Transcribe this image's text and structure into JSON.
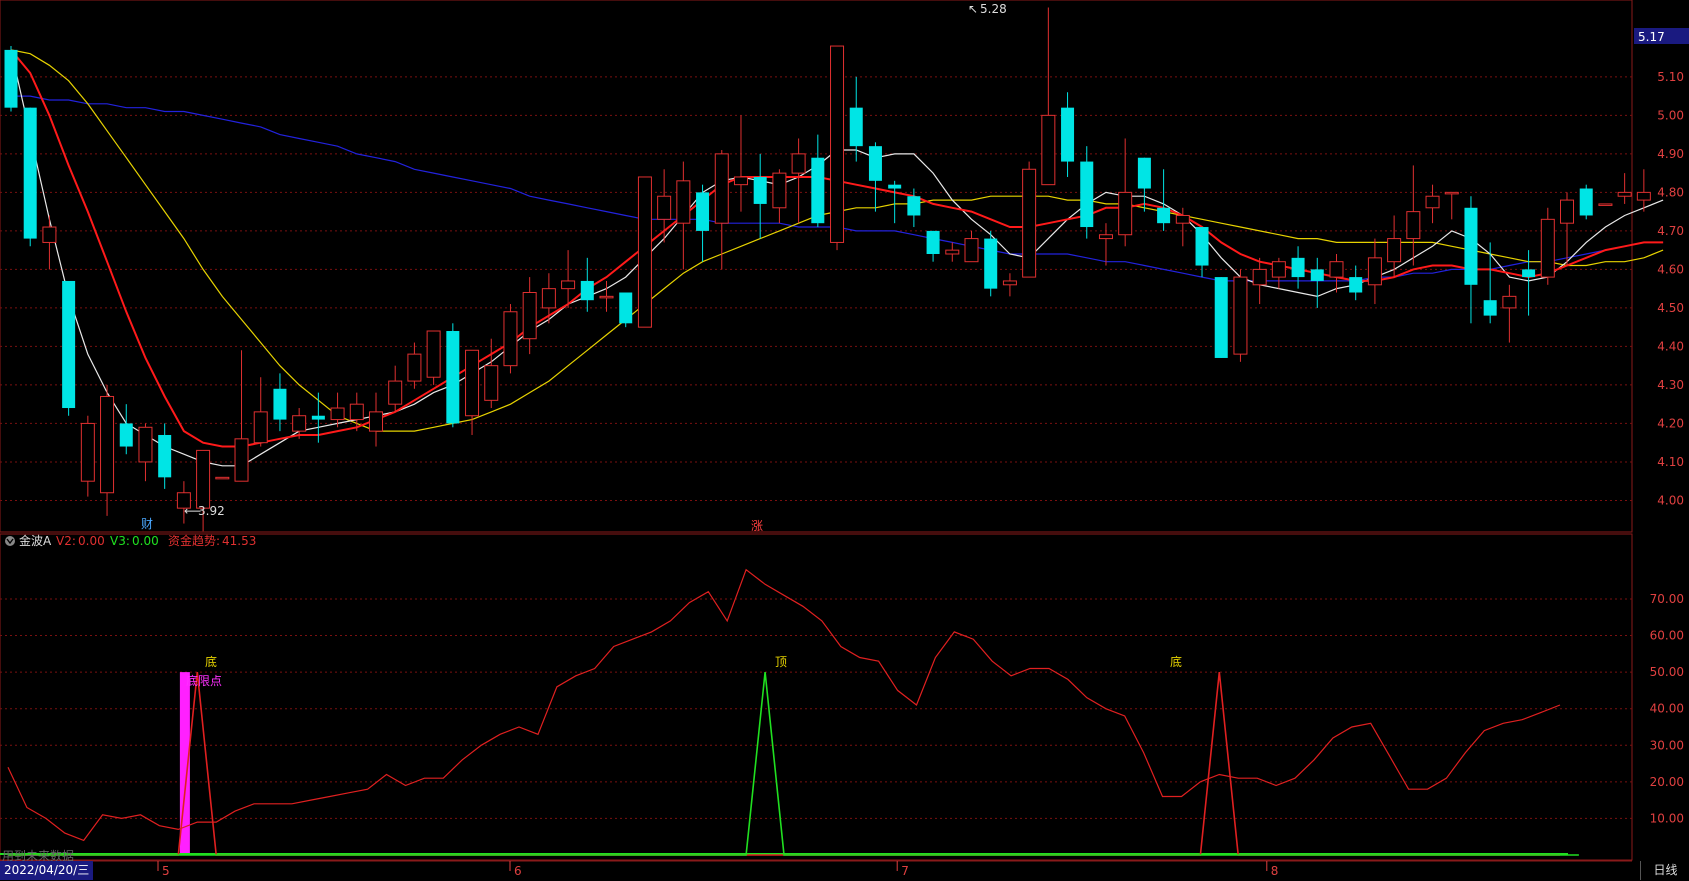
{
  "indicator": {
    "name": "金波A",
    "v2_label": "V2:",
    "v2_value": "0.00",
    "v3_label": "V3:",
    "v3_value": "0.00",
    "trend_label": "资金趋势:",
    "trend_value": "41.53"
  },
  "labels": {
    "price_high": "5.28",
    "price_low": "3.92",
    "event_cai": "财",
    "event_zhang": "涨",
    "signal_di": "底",
    "signal_ding": "顶",
    "signal_didian": "底限点",
    "current_price": "5.17",
    "future_note": "用到未来数据",
    "date": "2022/04/20/三",
    "period": "日线"
  },
  "chart_data": [
    {
      "type": "candlestick",
      "y_ticks": [
        4.0,
        4.1,
        4.2,
        4.3,
        4.4,
        4.5,
        4.6,
        4.7,
        4.8,
        4.9,
        5.0,
        5.1
      ],
      "y_tick_labels": [
        "4.00",
        "4.10",
        "4.20",
        "4.30",
        "4.40",
        "4.50",
        "4.60",
        "4.70",
        "4.80",
        "4.90",
        "5.00",
        "5.10"
      ],
      "ylim": [
        3.9,
        5.3
      ],
      "x_month_labels": [
        {
          "index": 8,
          "label": "5"
        },
        {
          "index": 28,
          "label": "6"
        },
        {
          "index": 50,
          "label": "7"
        },
        {
          "index": 71,
          "label": "8"
        }
      ],
      "candles": [
        [
          5.17,
          5.02,
          5.18,
          5.01
        ],
        [
          5.02,
          4.68,
          5.02,
          4.66
        ],
        [
          4.67,
          4.71,
          4.74,
          4.6
        ],
        [
          4.57,
          4.24,
          4.57,
          4.22
        ],
        [
          4.05,
          4.2,
          4.22,
          4.01
        ],
        [
          4.02,
          4.27,
          4.3,
          3.96
        ],
        [
          4.2,
          4.14,
          4.25,
          4.12
        ],
        [
          4.1,
          4.19,
          4.2,
          4.05
        ],
        [
          4.17,
          4.06,
          4.2,
          4.03
        ],
        [
          3.98,
          4.02,
          4.05,
          3.94
        ],
        [
          3.98,
          4.13,
          4.13,
          3.92
        ],
        [
          4.06,
          4.06,
          4.06,
          4.06
        ],
        [
          4.05,
          4.16,
          4.39,
          4.05
        ],
        [
          4.15,
          4.23,
          4.32,
          4.14
        ],
        [
          4.29,
          4.21,
          4.33,
          4.18
        ],
        [
          4.18,
          4.22,
          4.24,
          4.16
        ],
        [
          4.22,
          4.21,
          4.28,
          4.15
        ],
        [
          4.21,
          4.24,
          4.28,
          4.19
        ],
        [
          4.21,
          4.25,
          4.28,
          4.18
        ],
        [
          4.18,
          4.23,
          4.28,
          4.14
        ],
        [
          4.25,
          4.31,
          4.35,
          4.23
        ],
        [
          4.31,
          4.38,
          4.41,
          4.29
        ],
        [
          4.32,
          4.44,
          4.44,
          4.3
        ],
        [
          4.44,
          4.2,
          4.46,
          4.19
        ],
        [
          4.22,
          4.39,
          4.39,
          4.17
        ],
        [
          4.26,
          4.35,
          4.42,
          4.24
        ],
        [
          4.35,
          4.49,
          4.51,
          4.33
        ],
        [
          4.42,
          4.54,
          4.58,
          4.38
        ],
        [
          4.5,
          4.55,
          4.59,
          4.46
        ],
        [
          4.55,
          4.57,
          4.65,
          4.5
        ],
        [
          4.57,
          4.52,
          4.63,
          4.49
        ],
        [
          4.53,
          4.53,
          4.57,
          4.49
        ],
        [
          4.54,
          4.46,
          4.54,
          4.45
        ],
        [
          4.45,
          4.84,
          4.84,
          4.45
        ],
        [
          4.73,
          4.79,
          4.86,
          4.67
        ],
        [
          4.72,
          4.83,
          4.88,
          4.6
        ],
        [
          4.8,
          4.7,
          4.82,
          4.62
        ],
        [
          4.72,
          4.9,
          4.91,
          4.6
        ],
        [
          4.82,
          4.84,
          5.0,
          4.75
        ],
        [
          4.84,
          4.77,
          4.9,
          4.68
        ],
        [
          4.76,
          4.85,
          4.86,
          4.72
        ],
        [
          4.85,
          4.9,
          4.94,
          4.72
        ],
        [
          4.89,
          4.72,
          4.95,
          4.71
        ],
        [
          4.67,
          5.18,
          5.18,
          4.65
        ],
        [
          5.02,
          4.92,
          5.1,
          4.88
        ],
        [
          4.92,
          4.83,
          4.93,
          4.75
        ],
        [
          4.82,
          4.81,
          4.83,
          4.72
        ],
        [
          4.79,
          4.74,
          4.81,
          4.71
        ],
        [
          4.7,
          4.64,
          4.7,
          4.62
        ],
        [
          4.64,
          4.65,
          4.67,
          4.62
        ],
        [
          4.62,
          4.68,
          4.7,
          4.62
        ],
        [
          4.68,
          4.55,
          4.7,
          4.53
        ],
        [
          4.56,
          4.57,
          4.59,
          4.53
        ],
        [
          4.58,
          4.86,
          4.88,
          4.6
        ],
        [
          4.82,
          5.0,
          5.28,
          4.82
        ],
        [
          5.02,
          4.88,
          5.06,
          4.84
        ],
        [
          4.88,
          4.71,
          4.92,
          4.68
        ],
        [
          4.68,
          4.69,
          4.72,
          4.61
        ],
        [
          4.69,
          4.8,
          4.94,
          4.66
        ],
        [
          4.89,
          4.81,
          4.89,
          4.75
        ],
        [
          4.76,
          4.72,
          4.86,
          4.7
        ],
        [
          4.72,
          4.74,
          4.76,
          4.66
        ],
        [
          4.71,
          4.61,
          4.71,
          4.58
        ],
        [
          4.58,
          4.37,
          4.58,
          4.37
        ],
        [
          4.38,
          4.58,
          4.6,
          4.36
        ],
        [
          4.56,
          4.6,
          4.63,
          4.51
        ],
        [
          4.58,
          4.62,
          4.63,
          4.55
        ],
        [
          4.63,
          4.58,
          4.66,
          4.55
        ],
        [
          4.6,
          4.57,
          4.63,
          4.5
        ],
        [
          4.58,
          4.62,
          4.64,
          4.54
        ],
        [
          4.58,
          4.54,
          4.61,
          4.52
        ],
        [
          4.56,
          4.63,
          4.68,
          4.51
        ],
        [
          4.62,
          4.68,
          4.74,
          4.58
        ],
        [
          4.68,
          4.75,
          4.87,
          4.61
        ],
        [
          4.76,
          4.79,
          4.82,
          4.72
        ],
        [
          4.8,
          4.8,
          4.8,
          4.73
        ],
        [
          4.76,
          4.56,
          4.79,
          4.46
        ],
        [
          4.52,
          4.48,
          4.67,
          4.46
        ],
        [
          4.5,
          4.53,
          4.56,
          4.41
        ],
        [
          4.6,
          4.58,
          4.65,
          4.48
        ],
        [
          4.58,
          4.73,
          4.76,
          4.56
        ],
        [
          4.72,
          4.78,
          4.8,
          4.61
        ],
        [
          4.81,
          4.74,
          4.82,
          4.73
        ],
        [
          4.77,
          4.77,
          4.77,
          4.77
        ],
        [
          4.79,
          4.8,
          4.85,
          4.77
        ],
        [
          4.78,
          4.8,
          4.86,
          4.75
        ]
      ],
      "ma_white": [
        5.17,
        4.95,
        4.73,
        4.53,
        4.38,
        4.28,
        4.2,
        4.17,
        4.14,
        4.12,
        4.1,
        4.09,
        4.09,
        4.12,
        4.15,
        4.18,
        4.19,
        4.2,
        4.21,
        4.22,
        4.23,
        4.25,
        4.28,
        4.3,
        4.33,
        4.36,
        4.4,
        4.44,
        4.47,
        4.51,
        4.53,
        4.55,
        4.58,
        4.63,
        4.68,
        4.74,
        4.8,
        4.83,
        4.84,
        4.83,
        4.82,
        4.84,
        4.87,
        4.91,
        4.91,
        4.89,
        4.9,
        4.9,
        4.85,
        4.78,
        4.73,
        4.69,
        4.64,
        4.63,
        4.68,
        4.73,
        4.77,
        4.8,
        4.79,
        4.79,
        4.77,
        4.74,
        4.69,
        4.63,
        4.58,
        4.56,
        4.55,
        4.54,
        4.53,
        4.55,
        4.56,
        4.58,
        4.6,
        4.63,
        4.66,
        4.7,
        4.68,
        4.64,
        4.58,
        4.57,
        4.58,
        4.62,
        4.67,
        4.71,
        4.74,
        4.76,
        4.78
      ],
      "ma_red": [
        5.17,
        5.11,
        5.0,
        4.87,
        4.75,
        4.62,
        4.49,
        4.37,
        4.27,
        4.18,
        4.15,
        4.14,
        4.14,
        4.15,
        4.16,
        4.17,
        4.17,
        4.18,
        4.19,
        4.21,
        4.23,
        4.26,
        4.29,
        4.32,
        4.35,
        4.38,
        4.41,
        4.45,
        4.48,
        4.51,
        4.55,
        4.58,
        4.62,
        4.66,
        4.7,
        4.74,
        4.78,
        4.82,
        4.84,
        4.84,
        4.84,
        4.84,
        4.84,
        4.83,
        4.82,
        4.81,
        4.8,
        4.79,
        4.77,
        4.76,
        4.75,
        4.73,
        4.71,
        4.71,
        4.72,
        4.73,
        4.74,
        4.76,
        4.76,
        4.77,
        4.76,
        4.74,
        4.71,
        4.67,
        4.64,
        4.62,
        4.61,
        4.6,
        4.59,
        4.58,
        4.57,
        4.57,
        4.58,
        4.6,
        4.61,
        4.61,
        4.6,
        4.6,
        4.59,
        4.58,
        4.59,
        4.61,
        4.63,
        4.65,
        4.66,
        4.67,
        4.67
      ],
      "ma_yellow": [
        5.17,
        5.16,
        5.13,
        5.09,
        5.03,
        4.96,
        4.89,
        4.82,
        4.75,
        4.68,
        4.6,
        4.53,
        4.47,
        4.41,
        4.35,
        4.3,
        4.26,
        4.22,
        4.2,
        4.18,
        4.18,
        4.18,
        4.19,
        4.2,
        4.21,
        4.23,
        4.25,
        4.28,
        4.31,
        4.35,
        4.39,
        4.43,
        4.47,
        4.51,
        4.55,
        4.59,
        4.62,
        4.64,
        4.66,
        4.68,
        4.7,
        4.72,
        4.74,
        4.75,
        4.76,
        4.76,
        4.77,
        4.77,
        4.78,
        4.78,
        4.78,
        4.79,
        4.79,
        4.79,
        4.79,
        4.78,
        4.78,
        4.77,
        4.77,
        4.76,
        4.75,
        4.74,
        4.73,
        4.72,
        4.71,
        4.7,
        4.69,
        4.68,
        4.68,
        4.67,
        4.67,
        4.67,
        4.67,
        4.67,
        4.67,
        4.66,
        4.65,
        4.64,
        4.63,
        4.62,
        4.62,
        4.61,
        4.61,
        4.62,
        4.62,
        4.63,
        4.65
      ],
      "ma_blue": [
        5.05,
        5.05,
        5.04,
        5.04,
        5.03,
        5.03,
        5.02,
        5.02,
        5.01,
        5.01,
        5.0,
        4.99,
        4.98,
        4.97,
        4.95,
        4.94,
        4.93,
        4.92,
        4.9,
        4.89,
        4.88,
        4.86,
        4.85,
        4.84,
        4.83,
        4.82,
        4.81,
        4.79,
        4.78,
        4.77,
        4.76,
        4.75,
        4.74,
        4.73,
        4.73,
        4.73,
        4.73,
        4.72,
        4.72,
        4.72,
        4.72,
        4.71,
        4.71,
        4.71,
        4.7,
        4.7,
        4.7,
        4.69,
        4.68,
        4.67,
        4.66,
        4.65,
        4.64,
        4.64,
        4.64,
        4.64,
        4.63,
        4.62,
        4.62,
        4.61,
        4.6,
        4.59,
        4.58,
        4.57,
        4.57,
        4.57,
        4.57,
        4.57,
        4.57,
        4.57,
        4.57,
        4.58,
        4.58,
        4.59,
        4.59,
        4.6,
        4.6,
        4.6,
        4.61,
        4.62,
        4.62,
        4.63,
        4.64,
        4.65,
        4.66,
        4.67,
        4.67
      ]
    },
    {
      "type": "line",
      "y_ticks": [
        10,
        20,
        30,
        40,
        50,
        60,
        70
      ],
      "y_tick_labels": [
        "10.00",
        "20.00",
        "30.00",
        "40.00",
        "50.00",
        "60.00",
        "70.00"
      ],
      "ylim": [
        0,
        80
      ],
      "series": [
        {
          "color": "#e02020",
          "values": [
            24,
            13,
            10,
            6,
            4,
            11,
            10,
            11,
            8,
            7,
            9,
            9,
            12,
            14,
            14,
            14,
            15,
            16,
            17,
            18,
            22,
            19,
            21,
            21,
            26,
            30,
            33,
            35,
            33,
            46,
            49,
            51,
            57,
            59,
            61,
            64,
            69,
            72,
            64,
            78,
            74,
            71,
            68,
            64,
            57,
            54,
            53,
            45,
            41,
            54,
            61,
            59,
            53,
            49,
            51,
            51,
            48,
            43,
            40,
            38,
            28,
            16,
            16,
            20,
            22,
            21,
            21,
            19,
            21,
            26,
            32,
            35,
            36,
            27,
            18,
            18,
            21,
            28,
            34,
            36,
            37,
            39,
            41
          ]
        },
        {
          "color": "#e02020",
          "values": [
            0,
            0,
            0,
            0,
            0,
            0,
            0,
            0,
            0,
            0,
            50,
            0,
            0,
            0,
            0,
            0,
            0,
            0,
            0,
            0,
            0,
            0,
            0,
            0,
            0,
            0,
            0,
            0,
            0,
            0,
            0,
            0,
            0,
            0,
            0,
            0,
            0,
            0,
            0,
            0,
            0,
            0,
            0,
            0,
            0,
            0,
            0,
            0,
            0,
            0,
            0,
            0,
            0,
            0,
            0,
            0,
            0,
            0,
            0,
            0,
            0,
            0,
            0,
            0,
            50,
            0,
            0,
            0,
            0,
            0,
            0,
            0,
            0,
            0,
            0,
            0,
            0,
            0,
            0,
            0,
            0,
            0,
            0
          ]
        },
        {
          "color": "#20e020",
          "values": [
            0,
            0,
            0,
            0,
            0,
            0,
            0,
            0,
            0,
            0,
            0,
            0,
            0,
            0,
            0,
            0,
            0,
            0,
            0,
            0,
            0,
            0,
            0,
            0,
            0,
            0,
            0,
            0,
            0,
            0,
            0,
            0,
            0,
            0,
            0,
            0,
            0,
            0,
            0,
            0,
            50,
            0,
            0,
            0,
            0,
            0,
            0,
            0,
            0,
            0,
            0,
            0,
            0,
            0,
            0,
            0,
            0,
            0,
            0,
            0,
            0,
            0,
            0,
            0,
            0,
            0,
            0,
            0,
            0,
            0,
            0,
            0,
            0,
            0,
            0,
            0,
            0,
            0,
            0,
            0,
            0,
            0,
            0,
            0
          ]
        }
      ],
      "bars": [
        {
          "index": 9,
          "value": 50,
          "color": "#ff20ff"
        }
      ]
    }
  ],
  "colors": {
    "up": "#e03030",
    "down": "#00e5e5",
    "grid": "#7a1010",
    "axis_text": "#e04040",
    "ma_white": "#e8e8e8",
    "ma_red": "#ff1a1a",
    "ma_yellow": "#e6d200",
    "ma_blue": "#2222dd"
  }
}
